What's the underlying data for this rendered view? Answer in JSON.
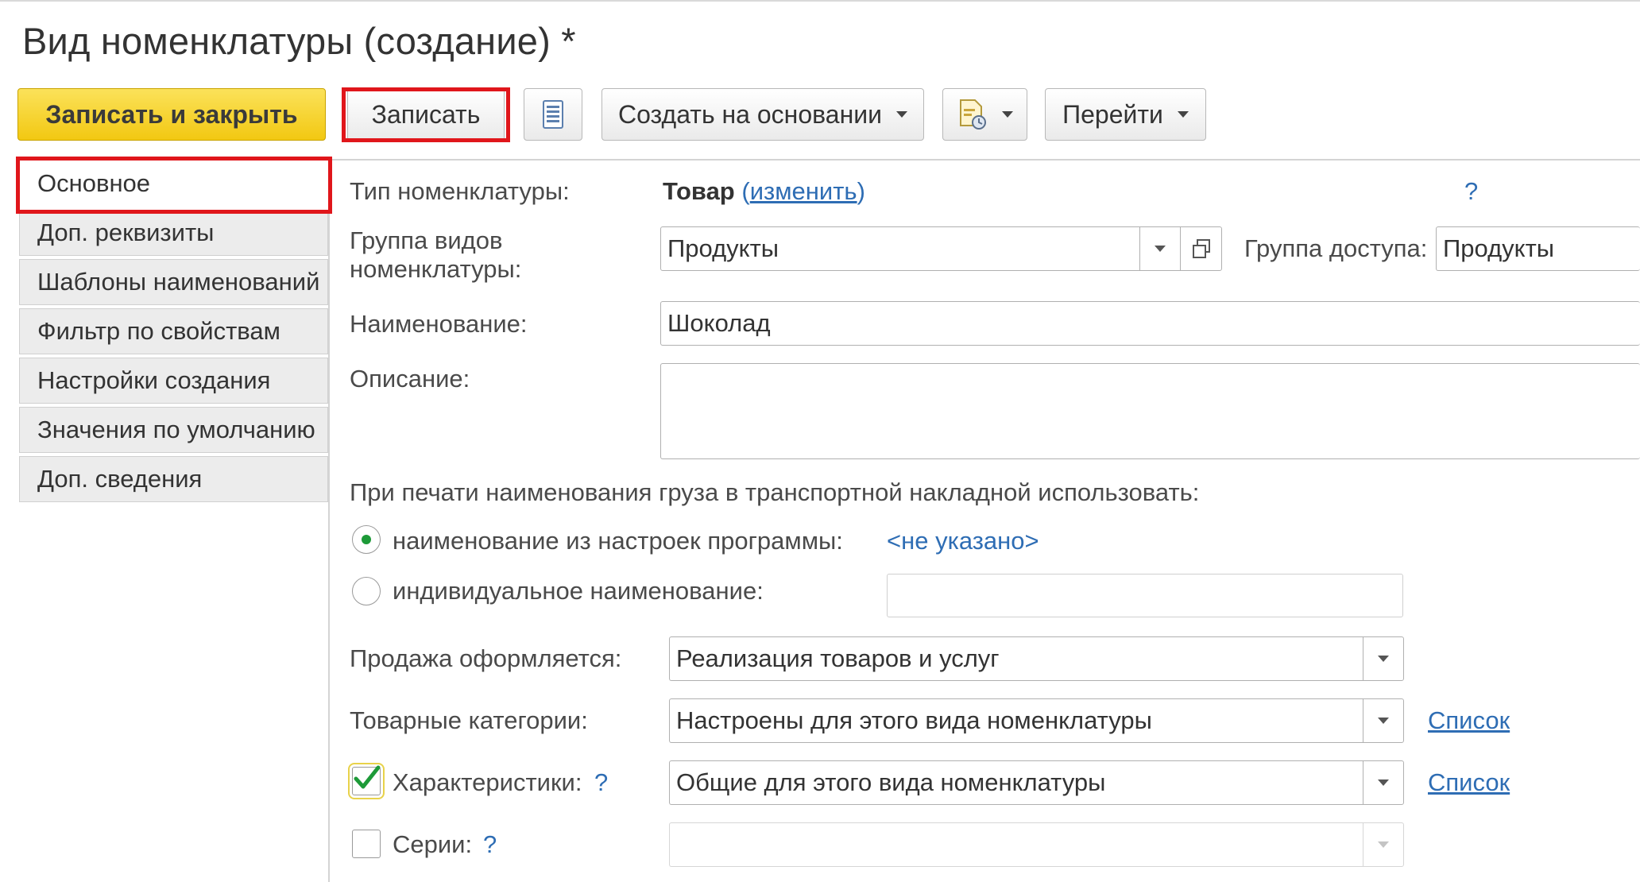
{
  "window": {
    "title": "Вид номенклатуры (создание) *"
  },
  "toolbar": {
    "save_close_label": "Записать и закрыть",
    "save_label": "Записать",
    "list_icon": "list-icon",
    "create_based_label": "Создать на основании",
    "report_icon": "report-settings-icon",
    "goto_label": "Перейти"
  },
  "sidebar": {
    "items": [
      {
        "label": "Основное",
        "active": true
      },
      {
        "label": "Доп. реквизиты",
        "active": false
      },
      {
        "label": "Шаблоны наименований",
        "active": false
      },
      {
        "label": "Фильтр по свойствам",
        "active": false
      },
      {
        "label": "Настройки создания",
        "active": false
      },
      {
        "label": "Значения по умолчанию",
        "active": false
      },
      {
        "label": "Доп. сведения",
        "active": false
      }
    ]
  },
  "form": {
    "type_label": "Тип номенклатуры:",
    "type_value": "Товар",
    "type_change_open": "(",
    "type_change_link": "изменить",
    "type_change_close": ")",
    "help_mark": "?",
    "group_label_line1": "Группа видов",
    "group_label_line2": "номенклатуры:",
    "group_value": "Продукты",
    "access_group_label": "Группа доступа:",
    "access_group_value": "Продукты",
    "name_label": "Наименование:",
    "name_value": "Шоколад",
    "description_label": "Описание:",
    "description_value": "",
    "print_label": "При печати наименования груза в транспортной накладной использовать:",
    "radio_program_label": "наименование из настроек программы:",
    "radio_program_selected": true,
    "not_specified": "<не указано>",
    "radio_individual_label": "индивидуальное наименование:",
    "individual_value": "",
    "sale_label": "Продажа оформляется:",
    "sale_value": "Реализация товаров и услуг",
    "categories_label": "Товарные категории:",
    "categories_value": "Настроены для этого вида номенклатуры",
    "list_link": "Список",
    "characteristics_label": "Характеристики:",
    "characteristics_checked": true,
    "characteristics_value": "Общие для этого вида номенклатуры",
    "series_label": "Серии:",
    "series_checked": false,
    "series_value": ""
  },
  "colors": {
    "primary_button": "#f5d02a",
    "highlight_frame": "#e0161b",
    "link": "#2e6db4",
    "radio_selected": "#1d9a38"
  }
}
